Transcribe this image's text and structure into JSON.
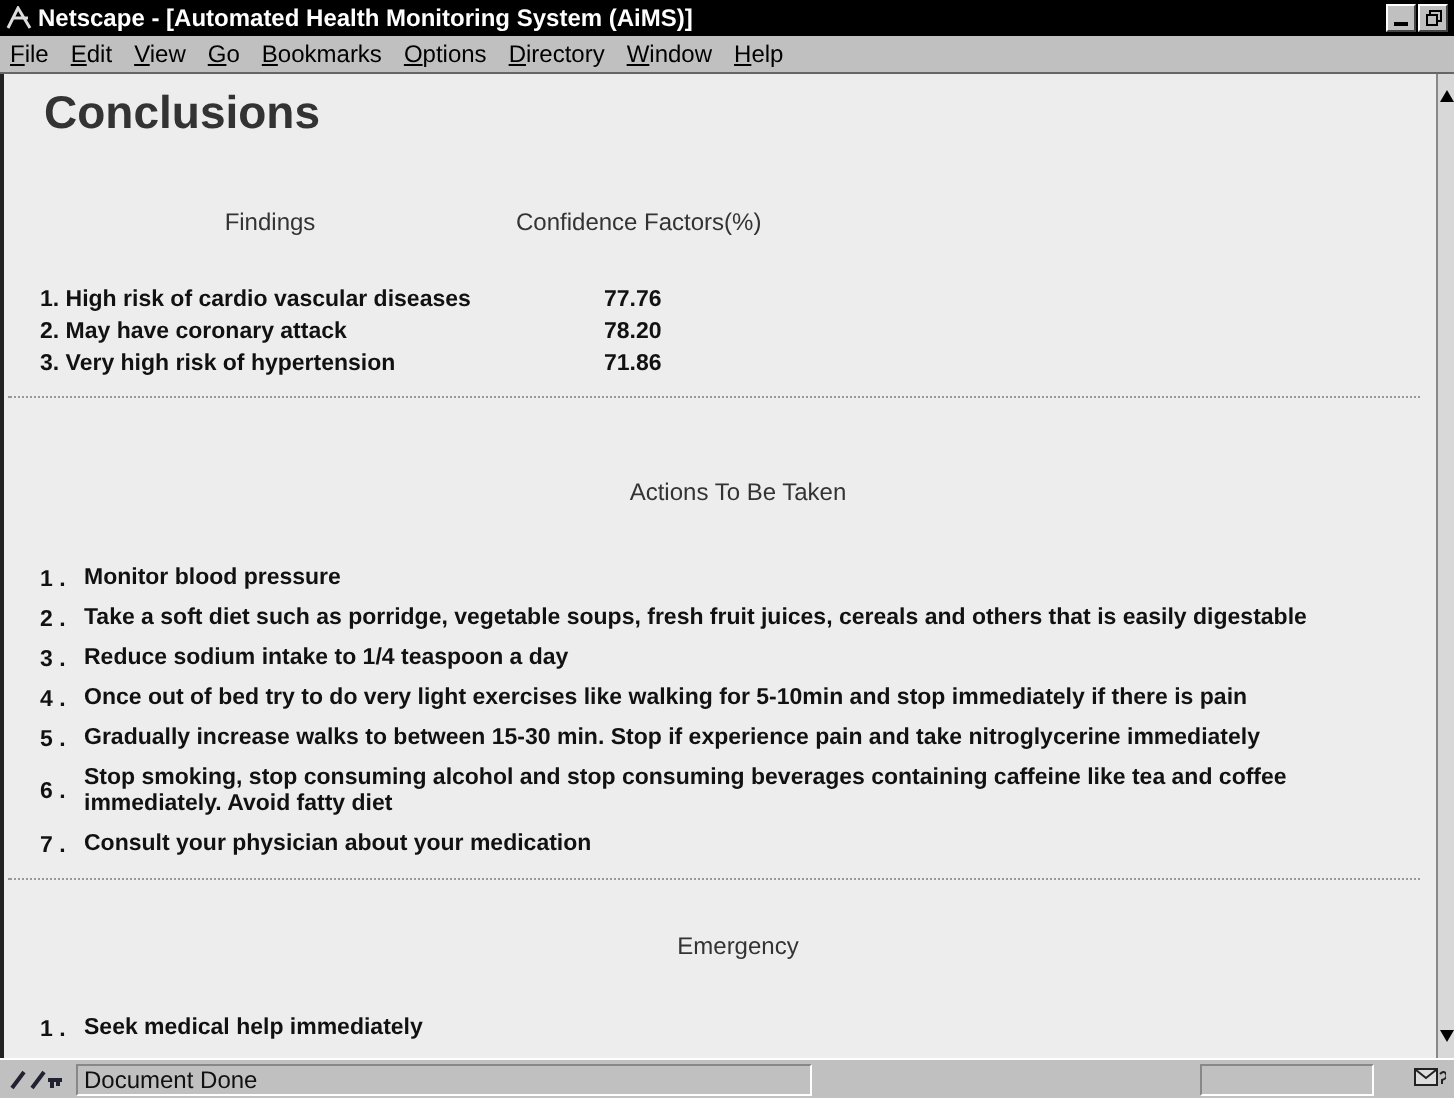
{
  "window": {
    "title": "Netscape - [Automated Health Monitoring System (AiMS)]"
  },
  "menu": [
    "File",
    "Edit",
    "View",
    "Go",
    "Bookmarks",
    "Options",
    "Directory",
    "Window",
    "Help"
  ],
  "page": {
    "heading": "Conclusions",
    "findings": {
      "columns": [
        "Findings",
        "Confidence Factors(%)"
      ],
      "rows": [
        {
          "finding": "1. High risk of cardio vascular diseases",
          "confidence": "77.76"
        },
        {
          "finding": "2. May have coronary attack",
          "confidence": "78.20"
        },
        {
          "finding": "3. Very high risk of hypertension",
          "confidence": "71.86"
        }
      ]
    },
    "actions": {
      "title": "Actions To Be Taken",
      "items": [
        {
          "number": "1 .",
          "text": "Monitor blood pressure"
        },
        {
          "number": "2 .",
          "text": "Take a soft diet such as porridge, vegetable soups, fresh fruit juices, cereals and others that is easily digestable"
        },
        {
          "number": "3 .",
          "text": "Reduce sodium intake to 1/4 teaspoon a day"
        },
        {
          "number": "4 .",
          "text": "Once out of bed try to do very light exercises like walking for 5-10min and stop immediately if there is pain"
        },
        {
          "number": "5 .",
          "text": "Gradually increase walks to between 15-30 min. Stop if experience pain and take nitroglycerine immediately"
        },
        {
          "number": "6 .",
          "text": "Stop smoking, stop consuming alcohol and stop consuming beverages containing caffeine like tea and coffee immediately. Avoid fatty diet"
        },
        {
          "number": "7 .",
          "text": "Consult your physician about your medication"
        }
      ]
    },
    "emergency": {
      "title": "Emergency",
      "items": [
        {
          "number": "1 .",
          "text": "Seek medical help immediately"
        }
      ]
    }
  },
  "status_bar": {
    "text": "Document Done"
  }
}
